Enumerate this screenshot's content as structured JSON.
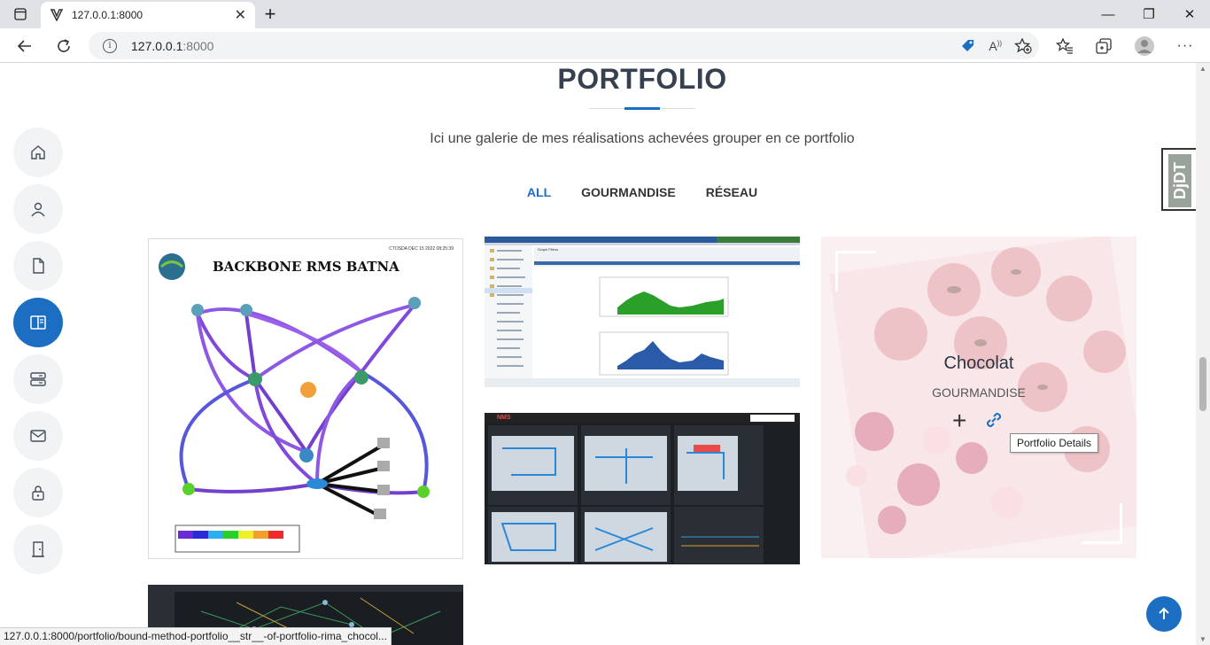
{
  "browser": {
    "tab_title": "127.0.0.1:8000",
    "url_host": "127.0.0.1",
    "url_port": ":8000"
  },
  "portfolio": {
    "title": "PORTFOLIO",
    "subtitle": "Ici une galerie de mes réalisations achevées grouper en ce portfolio",
    "filters": [
      "ALL",
      "GOURMANDISE",
      "RÉSEAU"
    ],
    "active_filter": "ALL",
    "items": [
      {
        "image_title": "BACKBONE RMS BATNA",
        "image_date": "CTOSDA DEC 15 2022 08:25:39"
      },
      {
        "image_label": "Graph Filters"
      },
      {
        "image_label": "NMS"
      },
      {
        "title": "Chocolat",
        "category": "GOURMANDISE",
        "tooltip": "Portfolio Details"
      },
      {
        "image_label": ""
      }
    ]
  },
  "sidenav": {
    "items": [
      "home",
      "about",
      "resume",
      "portfolio",
      "services",
      "contact",
      "login",
      "logout"
    ],
    "active": "portfolio"
  },
  "debug_toolbar": "DjDT",
  "status_url": "127.0.0.1:8000/portfolio/bound-method-portfolio__str__-of-portfolio-rima_chocol...",
  "colors": {
    "accent": "#1b6ec2",
    "heading": "#37404f"
  }
}
